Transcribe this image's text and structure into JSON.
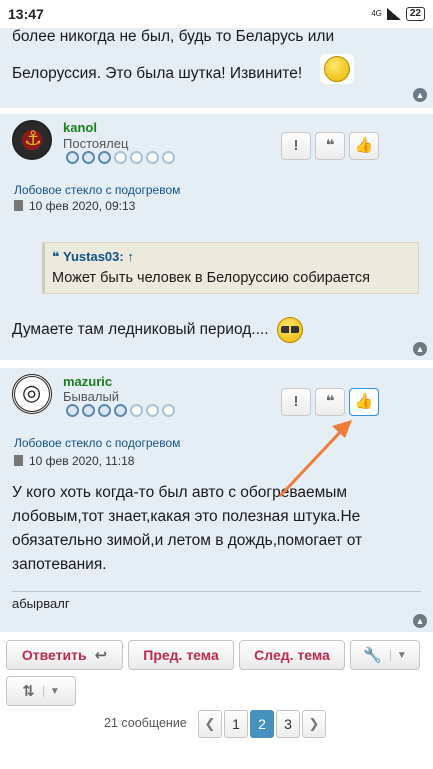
{
  "status_bar": {
    "time": "13:47",
    "network": "4G",
    "battery": "22"
  },
  "post1": {
    "line1": "более никогда не был, будь то Беларусь или",
    "line2": "Белоруссия. Это была шутка! Извините!"
  },
  "post2": {
    "username": "kanol",
    "rank": "Постоялец",
    "rank_dots_filled": 3,
    "topic": "Лобовое стекло с подогревом",
    "date": "10 фев 2020, 09:13",
    "quote_author": "Yustas03:",
    "quote_arrow": "↑",
    "quote_text": "Может быть человек в Белоруссию собирается",
    "body": "Думаете там ледниковый период...."
  },
  "post3": {
    "username": "mazuric",
    "rank": "Бывалый",
    "rank_dots_filled": 4,
    "topic": "Лобовое стекло с подогревом",
    "date": "10 фев 2020, 11:18",
    "body_lines": [
      "У кого хоть когда-то был авто с обогреваемым",
      "лобовым,тот знает,какая это полезная штука.Не",
      "обязательно зимой,и летом в дождь,помогает от",
      "запотевания."
    ],
    "signature": "абырвалг"
  },
  "post_actions": {
    "report": "!",
    "quote": "❝",
    "like": "👍"
  },
  "bottom_bar": {
    "reply": "Ответить",
    "prev_topic": "Пред. тема",
    "next_topic": "След. тема"
  },
  "pagination": {
    "count": "21 сообщение",
    "pages": [
      "1",
      "2",
      "3"
    ],
    "current": "2"
  },
  "colors": {
    "accent_button_text": "#bc2a4d",
    "link": "#105289",
    "username": "#1a7f1a",
    "page_active": "#4692bf",
    "arrow": "#f07a3a"
  }
}
